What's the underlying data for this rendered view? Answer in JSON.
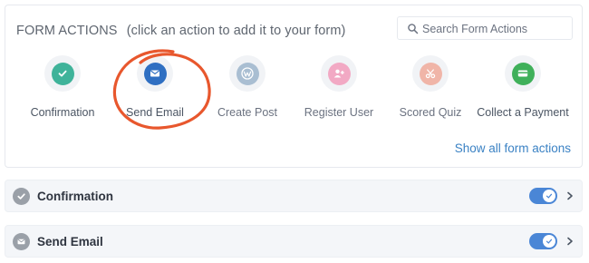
{
  "header": {
    "title": "FORM ACTIONS",
    "hint": "(click an action to add it to your form)"
  },
  "search": {
    "placeholder": "Search Form Actions",
    "value": ""
  },
  "actions": [
    {
      "label": "Confirmation",
      "icon": "check-icon",
      "color": "#3fb39a"
    },
    {
      "label": "Send Email",
      "icon": "envelope-icon",
      "color": "#2f6fc2"
    },
    {
      "label": "Create Post",
      "icon": "wordpress-icon",
      "color": "#a9bed2"
    },
    {
      "label": "Register User",
      "icon": "add-user-icon",
      "color": "#f2a9c4"
    },
    {
      "label": "Scored Quiz",
      "icon": "scissors-icon",
      "color": "#f0b5a8"
    },
    {
      "label": "Collect a Payment",
      "icon": "credit-card-icon",
      "color": "#3fb05a"
    }
  ],
  "annotation": {
    "icon": "highlight-circle",
    "color": "#e8572d"
  },
  "show_all_label": "Show all form actions",
  "accent_color": "#4a86d6",
  "rows": [
    {
      "title": "Confirmation",
      "icon": "check-icon",
      "enabled": true
    },
    {
      "title": "Send Email",
      "icon": "envelope-icon",
      "enabled": true
    }
  ]
}
